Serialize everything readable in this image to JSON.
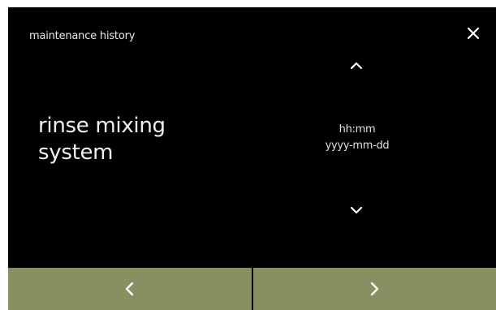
{
  "header": {
    "title": "maintenance history",
    "close_icon": "close-icon"
  },
  "main": {
    "item_name": "rinse mixing system",
    "time_label": "hh:mm",
    "date_label": "yyyy-mm-dd",
    "up_icon": "chevron-up-icon",
    "down_icon": "chevron-down-icon"
  },
  "footer": {
    "prev_icon": "chevron-left-icon",
    "next_icon": "chevron-right-icon",
    "button_color": "#8a8f62"
  },
  "colors": {
    "background": "#000000",
    "text": "#f0f0f0",
    "nav_button": "#8a8f62"
  }
}
